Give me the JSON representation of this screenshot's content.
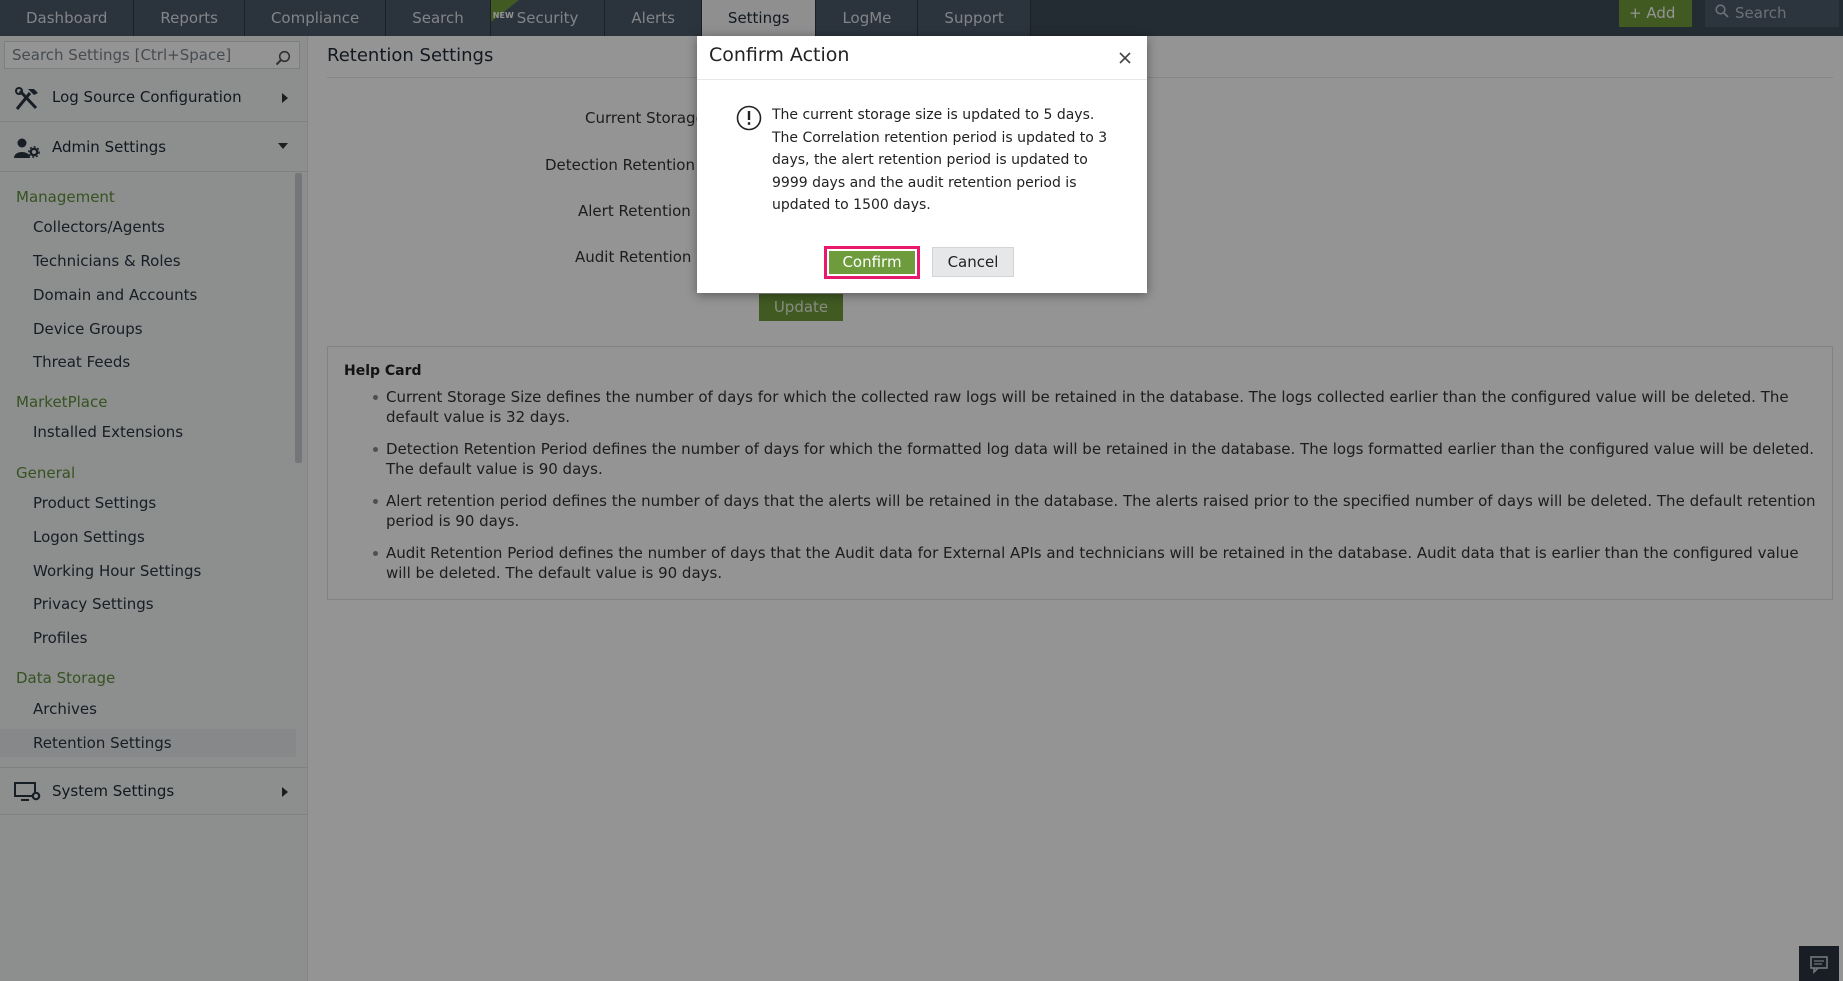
{
  "nav": {
    "tabs": [
      {
        "label": "Dashboard"
      },
      {
        "label": "Reports"
      },
      {
        "label": "Compliance"
      },
      {
        "label": "Search"
      },
      {
        "label": "Security",
        "badge": "NEW"
      },
      {
        "label": "Alerts"
      },
      {
        "label": "Settings"
      },
      {
        "label": "LogMe"
      },
      {
        "label": "Support"
      }
    ],
    "active_tab": "Settings",
    "add_label": "+ Add",
    "search_placeholder": "Search"
  },
  "sidebar": {
    "search_placeholder": "Search Settings [Ctrl+Space]",
    "log_source": "Log Source Configuration",
    "admin": "Admin Settings",
    "groups": {
      "management": "Management",
      "marketplace": "MarketPlace",
      "general": "General",
      "data_storage": "Data Storage"
    },
    "items": {
      "collectors": "Collectors/Agents",
      "technicians": "Technicians & Roles",
      "domain": "Domain and Accounts",
      "device_groups": "Device Groups",
      "threat_feeds": "Threat Feeds",
      "installed_ext": "Installed Extensions",
      "product_settings": "Product Settings",
      "logon_settings": "Logon Settings",
      "working_hour": "Working Hour Settings",
      "privacy": "Privacy Settings",
      "profiles": "Profiles",
      "archives": "Archives",
      "retention": "Retention Settings"
    },
    "system": "System Settings"
  },
  "main": {
    "title": "Retention Settings",
    "fields": {
      "current_storage": "Current Storage",
      "detection": "Detection Retention pe",
      "alert": "Alert Retention Pe",
      "audit": "Audit Retention Pe"
    },
    "update_label": "Update",
    "help": {
      "title": "Help Card",
      "items": [
        "Current Storage Size defines the number of days for which the collected raw logs will be retained in the database. The logs collected earlier than the configured value will be deleted. The default value is 32 days.",
        "Detection Retention Period defines the number of days for which the formatted log data will be retained in the database. The logs formatted earlier than the configured value will be deleted. The default value is 90 days.",
        "Alert retention period defines the number of days that the alerts will be retained in the database. The alerts raised prior to the specified number of days will be deleted. The default retention period is 90 days.",
        "Audit Retention Period defines the number of days that the Audit data for External APIs and technicians will be retained in the database. Audit data that is earlier than the configured value will be deleted. The default value is 90 days."
      ]
    }
  },
  "modal": {
    "title": "Confirm Action",
    "message": "The current storage size is updated to 5 days. The Correlation retention period is updated to 3 days, the alert retention period is updated to 9999 days and the audit retention period is updated to 1500 days.",
    "confirm_label": "Confirm",
    "cancel_label": "Cancel"
  },
  "colors": {
    "accent_green": "#6e9b3b",
    "highlight_pink": "#e8196a",
    "nav_bg": "#3d4a59"
  }
}
